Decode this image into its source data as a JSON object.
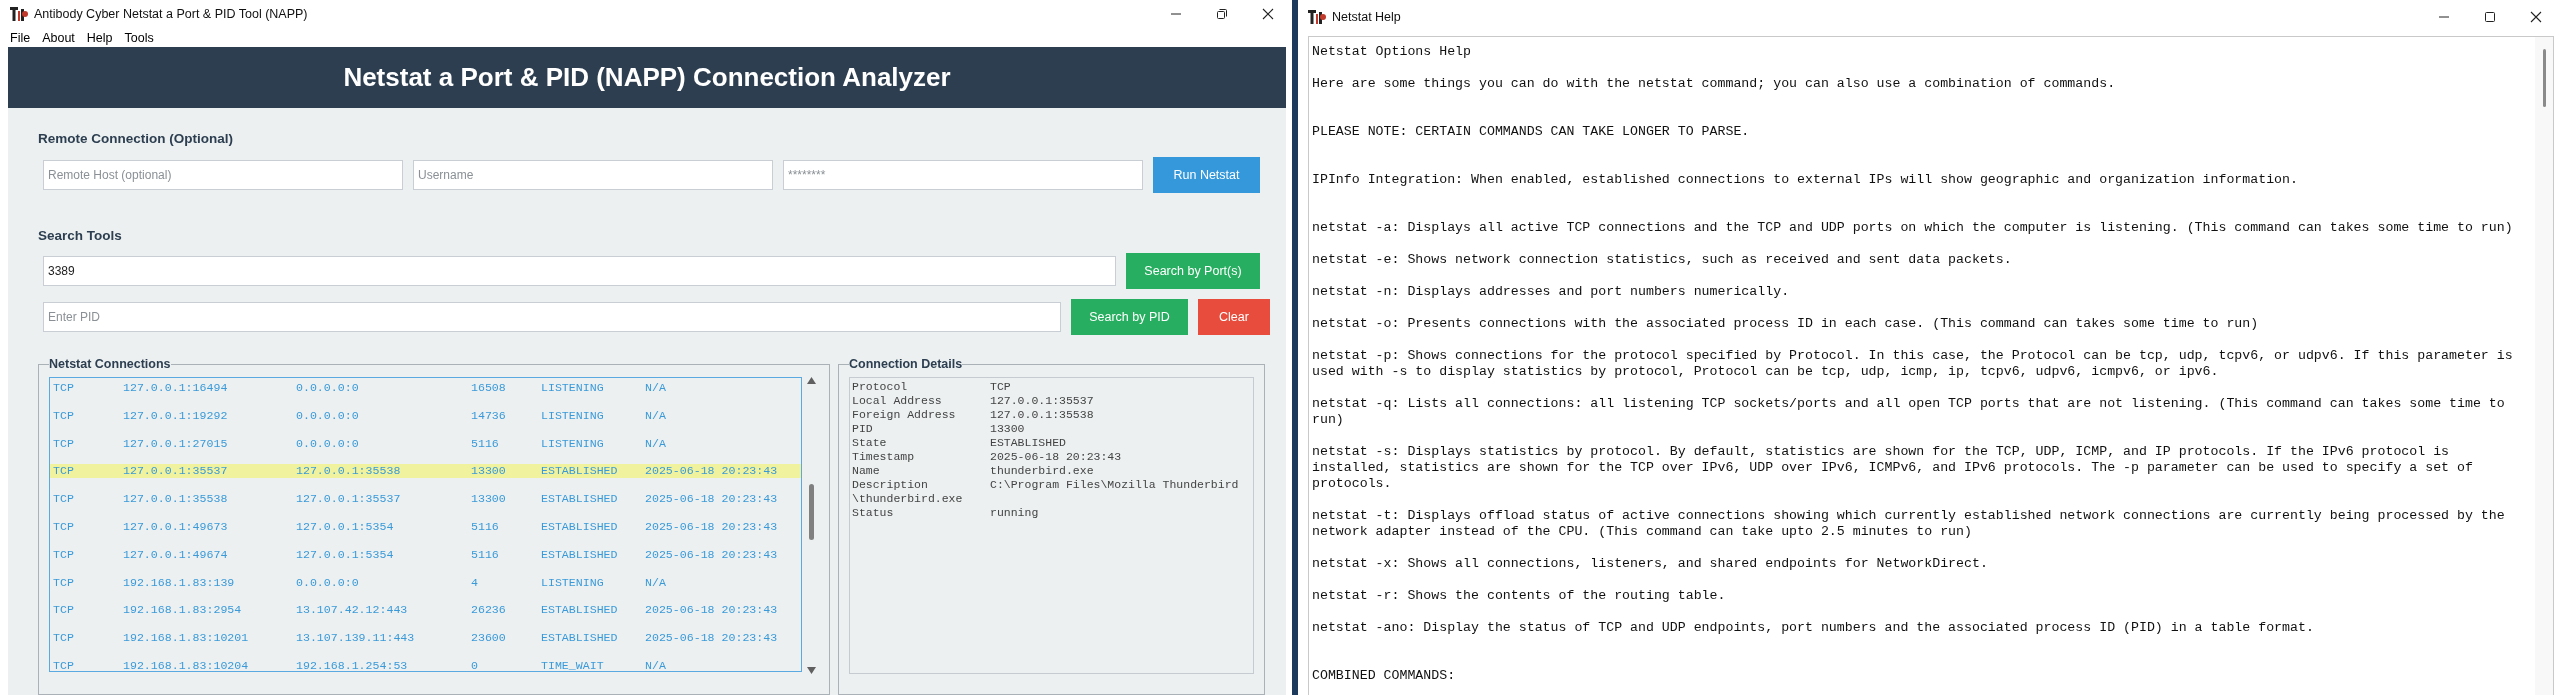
{
  "main_window": {
    "title": "Antibody Cyber Netstat a Port & PID Tool (NAPP)",
    "maximized": true,
    "menu": [
      "File",
      "About",
      "Help",
      "Tools"
    ],
    "header": "Netstat a Port & PID (NAPP) Connection Analyzer",
    "remote_connection": {
      "title": "Remote Connection (Optional)",
      "host": {
        "placeholder": "Remote Host (optional)"
      },
      "username": {
        "placeholder": "Username"
      },
      "password": {
        "placeholder": "********"
      },
      "button": "Run Netstat"
    },
    "search_tools": {
      "title": "Search Tools",
      "port": {
        "value": "3389"
      },
      "port_button": "Search by Port(s)",
      "pid": {
        "placeholder": "Enter PID"
      },
      "pid_button": "Search by PID",
      "clear_button": "Clear"
    },
    "connections": {
      "title": "Netstat Connections",
      "rows": [
        {
          "cells": [
            "TCP",
            "127.0.0.1:16494",
            "0.0.0.0:0",
            "16508",
            "LISTENING",
            "N/A"
          ],
          "selected": false
        },
        {
          "cells": [
            "TCP",
            "127.0.0.1:19292",
            "0.0.0.0:0",
            "14736",
            "LISTENING",
            "N/A"
          ],
          "selected": false
        },
        {
          "cells": [
            "TCP",
            "127.0.0.1:27015",
            "0.0.0.0:0",
            "5116",
            "LISTENING",
            "N/A"
          ],
          "selected": false
        },
        {
          "cells": [
            "TCP",
            "127.0.0.1:35537",
            "127.0.0.1:35538",
            "13300",
            "ESTABLISHED",
            "2025-06-18 20:23:43"
          ],
          "selected": true
        },
        {
          "cells": [
            "TCP",
            "127.0.0.1:35538",
            "127.0.0.1:35537",
            "13300",
            "ESTABLISHED",
            "2025-06-18 20:23:43"
          ],
          "selected": false
        },
        {
          "cells": [
            "TCP",
            "127.0.0.1:49673",
            "127.0.0.1:5354",
            "5116",
            "ESTABLISHED",
            "2025-06-18 20:23:43"
          ],
          "selected": false
        },
        {
          "cells": [
            "TCP",
            "127.0.0.1:49674",
            "127.0.0.1:5354",
            "5116",
            "ESTABLISHED",
            "2025-06-18 20:23:43"
          ],
          "selected": false
        },
        {
          "cells": [
            "TCP",
            "192.168.1.83:139",
            "0.0.0.0:0",
            "4",
            "LISTENING",
            "N/A"
          ],
          "selected": false
        },
        {
          "cells": [
            "TCP",
            "192.168.1.83:2954",
            "13.107.42.12:443",
            "26236",
            "ESTABLISHED",
            "2025-06-18 20:23:43"
          ],
          "selected": false
        },
        {
          "cells": [
            "TCP",
            "192.168.1.83:10201",
            "13.107.139.11:443",
            "23600",
            "ESTABLISHED",
            "2025-06-18 20:23:43"
          ],
          "selected": false
        },
        {
          "cells": [
            "TCP",
            "192.168.1.83:10204",
            "192.168.1.254:53",
            "0",
            "TIME_WAIT",
            "N/A"
          ],
          "selected": false
        }
      ]
    },
    "details": {
      "title": "Connection Details",
      "fields": [
        {
          "label": "Protocol",
          "value": "TCP"
        },
        {
          "label": "Local Address",
          "value": "127.0.0.1:35537"
        },
        {
          "label": "Foreign Address",
          "value": "127.0.0.1:35538"
        },
        {
          "label": "PID",
          "value": "13300"
        },
        {
          "label": "State",
          "value": "ESTABLISHED"
        },
        {
          "label": "Timestamp",
          "value": "2025-06-18 20:23:43"
        },
        {
          "label": "Name",
          "value": "thunderbird.exe"
        },
        {
          "label": "Description",
          "value": "C:\\Program Files\\Mozilla Thunderbird\\thunderbird.exe"
        },
        {
          "label": "Status",
          "value": "running"
        }
      ]
    }
  },
  "help_window": {
    "title": "Netstat Help",
    "maximized": false,
    "paragraphs": [
      {
        "kind": "item",
        "text": "Netstat Options Help"
      },
      {
        "kind": "item",
        "text": "Here are some things you can do with the netstat command; you can also use a combination of commands."
      },
      {
        "kind": "section",
        "text": "PLEASE NOTE: CERTAIN COMMANDS CAN TAKE LONGER TO PARSE."
      },
      {
        "kind": "section",
        "text": "IPInfo Integration: When enabled, established connections to external IPs will show geographic and organization information."
      },
      {
        "kind": "section",
        "text": "netstat -a: Displays all active TCP connections and the TCP and UDP ports on which the computer is listening. (This command can takes some time to run)"
      },
      {
        "kind": "item",
        "text": "netstat -e: Shows network connection statistics, such as received and sent data packets."
      },
      {
        "kind": "item",
        "text": "netstat -n: Displays addresses and port numbers numerically."
      },
      {
        "kind": "item",
        "text": "netstat -o: Presents connections with the associated process ID in each case. (This command can takes some time to run)"
      },
      {
        "kind": "item",
        "text": "netstat -p: Shows connections for the protocol specified by Protocol. In this case, the Protocol can be tcp, udp, tcpv6, or udpv6. If this parameter is used with -s to display statistics by protocol, Protocol can be tcp, udp, icmp, ip, tcpv6, udpv6, icmpv6, or ipv6."
      },
      {
        "kind": "item",
        "text": "netstat -q: Lists all connections: all listening TCP sockets/ports and all open TCP ports that are not listening. (This command can takes some time to run)"
      },
      {
        "kind": "item",
        "text": "netstat -s: Displays statistics by protocol. By default, statistics are shown for the TCP, UDP, ICMP, and IP protocols. If the IPv6 protocol is installed, statistics are shown for the TCP over IPv6, UDP over IPv6, ICMPv6, and IPv6 protocols. The -p parameter can be used to specify a set of protocols."
      },
      {
        "kind": "item",
        "text": "netstat -t: Displays offload status of active connections showing which currently established network connections are currently being processed by the network adapter instead of the CPU. (This command can take upto 2.5 minutes to run)"
      },
      {
        "kind": "item",
        "text": "netstat -x: Shows all connections, listeners, and shared endpoints for NetworkDirect."
      },
      {
        "kind": "item",
        "text": "netstat -r: Shows the contents of the routing table."
      },
      {
        "kind": "item",
        "text": "netstat -ano: Display the status of TCP and UDP endpoints, port numbers and the associated process ID (PID) in a table format."
      },
      {
        "kind": "section",
        "text": "COMBINED COMMANDS:"
      }
    ]
  }
}
